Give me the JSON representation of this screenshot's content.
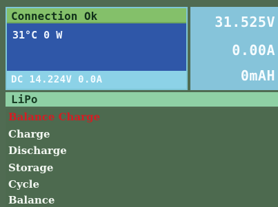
{
  "status": {
    "connection": "Connection Ok",
    "temp_power": "31°C   0 W",
    "dc_reading": "DC 14.224V    0.0A"
  },
  "readout": {
    "voltage": "31.525V",
    "current": "0.00A",
    "capacity": "0mAH"
  },
  "menu": {
    "battery_type": "LiPo",
    "items": [
      {
        "label": "Balance Charge",
        "selected": true
      },
      {
        "label": "Charge",
        "selected": false
      },
      {
        "label": "Discharge",
        "selected": false
      },
      {
        "label": "Storage",
        "selected": false
      },
      {
        "label": "Cycle",
        "selected": false
      },
      {
        "label": "Balance",
        "selected": false
      }
    ]
  },
  "colors": {
    "selected_item": "#d21e24",
    "connection_bar": "#84c06a",
    "status_panel": "#2f57a8",
    "readout_panel": "#86c4da"
  }
}
